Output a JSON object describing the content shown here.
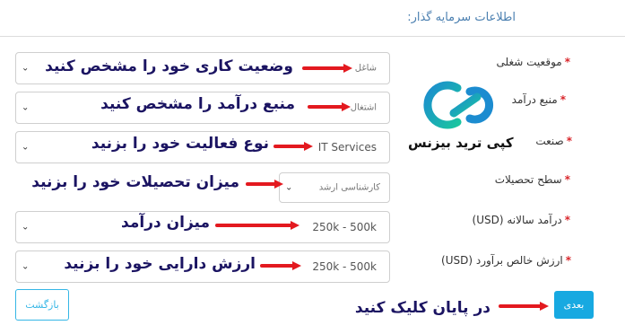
{
  "header": {
    "title": "اطلاعات سرمایه گذار:"
  },
  "fields": [
    {
      "label": "موقعیت شغلی",
      "required": "*",
      "value": "شاغل"
    },
    {
      "label": "منبع درآمد",
      "required": "*",
      "value": "اشتغال"
    },
    {
      "label": "صنعت",
      "required": "*",
      "value": "IT Services"
    },
    {
      "label": "سطح تحصیلات",
      "required": "*",
      "value": "کارشناسی ارشد"
    },
    {
      "label": "درآمد سالانه (USD)",
      "required": "*",
      "value": "250k - 500k"
    },
    {
      "label": "ارزش خالص برآورد (USD)",
      "required": "*",
      "value": "250k - 500k"
    }
  ],
  "annotations": [
    "وضعیت کاری خود را مشخص کنید",
    "منبع درآمد را مشخص کنید",
    "نوع فعالیت خود را بزنید",
    "میزان تحصیلات خود را بزنید",
    "میزان درآمد",
    "ارزش دارایی خود را بزنید",
    "در پایان کلیک کنید"
  ],
  "logo": {
    "text": "کپی ترید بیزنس",
    "color_primary": "#1c8cd0",
    "color_secondary": "#19c4a0"
  },
  "buttons": {
    "back": "بازگشت",
    "next": "بعدی"
  },
  "colors": {
    "arrow": "#e3191f",
    "annotation_text": "#1b1462",
    "required": "#d9262b",
    "accent": "#17a9e1"
  }
}
